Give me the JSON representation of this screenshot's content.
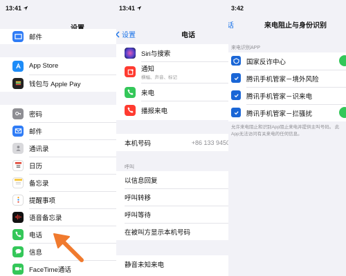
{
  "colors": {
    "accent": "#1a73e8",
    "arrow": "#f07a2e",
    "toggle_on": "#34c759",
    "app_blue": "#1a66d6"
  },
  "panel1": {
    "status_time": "13:41",
    "title": "设置",
    "top_item": "邮件",
    "items": [
      {
        "label": "App Store",
        "icon": "app-store-icon"
      },
      {
        "label": "钱包与 Apple Pay",
        "icon": "wallet-icon"
      },
      {
        "label": "密码",
        "icon": "key-icon"
      },
      {
        "label": "邮件",
        "icon": "mail-icon"
      },
      {
        "label": "通讯录",
        "icon": "contacts-icon"
      },
      {
        "label": "日历",
        "icon": "calendar-icon"
      },
      {
        "label": "备忘录",
        "icon": "notes-icon"
      },
      {
        "label": "提醒事项",
        "icon": "reminders-icon"
      },
      {
        "label": "语音备忘录",
        "icon": "voice-memos-icon"
      },
      {
        "label": "电话",
        "icon": "phone-icon"
      },
      {
        "label": "信息",
        "icon": "messages-icon"
      },
      {
        "label": "FaceTime通话",
        "icon": "facetime-icon"
      }
    ]
  },
  "panel2": {
    "status_time": "13:41",
    "back_label": "设置",
    "title": "电话",
    "items": [
      {
        "label": "Siri与搜索",
        "icon": "siri-icon"
      },
      {
        "label": "通知",
        "sub": "横幅、声音、标记",
        "icon": "notifications-icon"
      },
      {
        "label": "来电",
        "icon": "phone-icon"
      },
      {
        "label": "播报来电",
        "icon": "announce-calls-icon"
      }
    ],
    "my_number_label": "本机号码",
    "my_number_value": "+86 133 9450",
    "calls_header": "呼叫",
    "call_items": [
      "以信息回复",
      "呼叫转移",
      "呼叫等待",
      "在被叫方显示本机号码"
    ],
    "silence_label": "静音未知来电"
  },
  "panel3": {
    "status_time": "3:42",
    "back_label": "话",
    "title": "来电阻止与身份识别",
    "section_header": "来电识别APP",
    "apps": [
      "国家反诈中心",
      "腾讯手机管家－境外风险",
      "腾讯手机管家－识来电",
      "腾讯手机管家－拦骚扰"
    ],
    "footer": "允许来电阻止和识别App阻止来电并提供主叫号码。 此App无法访问有关来电的任何信息。"
  }
}
